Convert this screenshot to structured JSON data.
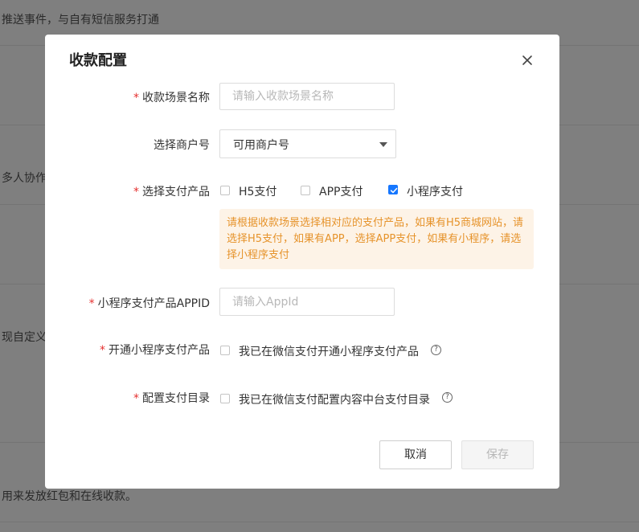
{
  "background": {
    "row1_text": "推送事件，与自有短信服务打通",
    "row2_text": "多人协作",
    "row3_text": "现自定义",
    "row4_text": "用来发放红包和在线收款。"
  },
  "modal": {
    "title": "收款配置",
    "close_icon": "close-icon",
    "fields": {
      "scene_name": {
        "label": "收款场景名称",
        "required": "*",
        "placeholder": "请输入收款场景名称",
        "value": ""
      },
      "merchant": {
        "label": "选择商户号",
        "selected": "可用商户号"
      },
      "pay_product": {
        "label": "选择支付产品",
        "required": "*",
        "options": [
          {
            "label": "H5支付",
            "checked": false
          },
          {
            "label": "APP支付",
            "checked": false
          },
          {
            "label": "小程序支付",
            "checked": true
          }
        ],
        "notice": "请根据收款场景选择相对应的支付产品，如果有H5商城网站，请选择H5支付，如果有APP，选择APP支付，如果有小程序，请选择小程序支付"
      },
      "appid": {
        "label": "小程序支付产品APPID",
        "required": "*",
        "placeholder": "请输入AppId",
        "value": ""
      },
      "open_product": {
        "label": "开通小程序支付产品",
        "required": "*",
        "checkbox_label": "我已在微信支付开通小程序支付产品",
        "checked": false,
        "help_glyph": "?"
      },
      "pay_dir": {
        "label": "配置支付目录",
        "required": "*",
        "checkbox_label": "我已在微信支付配置内容中台支付目录",
        "checked": false,
        "help_glyph": "?"
      }
    },
    "buttons": {
      "cancel": "取消",
      "save": "保存"
    }
  },
  "colors": {
    "required": "#e5302f",
    "checkbox_checked": "#1677ff",
    "notice_bg": "#fdf3e7",
    "notice_text": "#e6932b"
  }
}
